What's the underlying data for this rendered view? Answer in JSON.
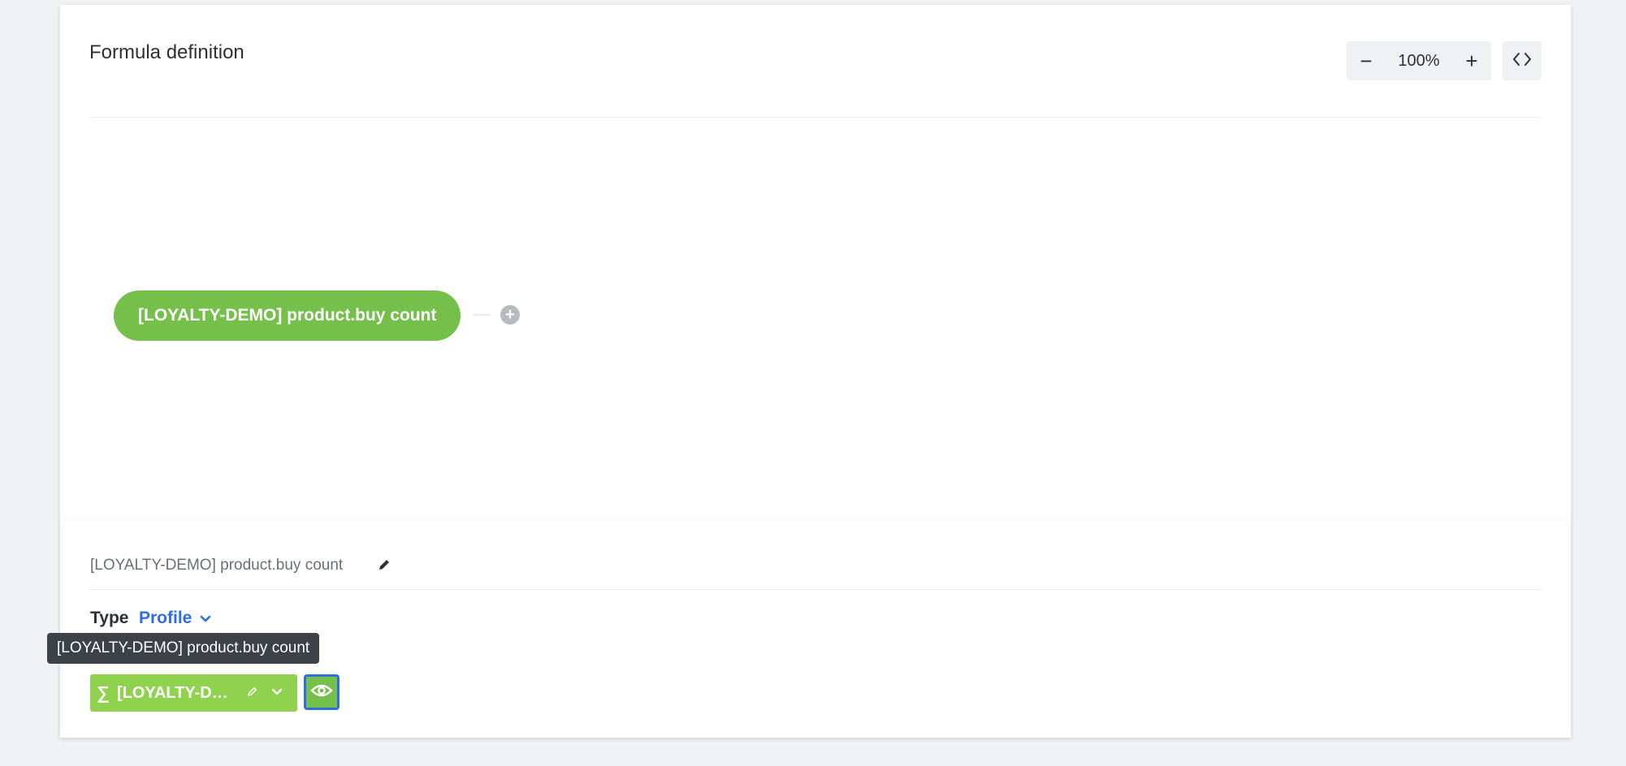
{
  "header": {
    "title": "Formula definition",
    "zoom_out_label": "−",
    "zoom_value": "100%",
    "zoom_in_label": "+"
  },
  "canvas": {
    "node_label": "[LOYALTY-DEMO] product.buy count",
    "add_node_label": "+"
  },
  "details": {
    "formula_name": "[LOYALTY-DEMO] product.buy count",
    "type_label": "Type",
    "type_value": "Profile",
    "tooltip": "[LOYALTY-DEMO] product.buy count",
    "chip_symbol": "∑",
    "chip_label": "[LOYALTY-DEMO] product.buy count"
  },
  "colors": {
    "node_green": "#75c04a",
    "chip_green": "#8ed24d",
    "accent_blue": "#2e6fe0",
    "tooltip_bg": "#3d4148"
  },
  "icons": {
    "code_toggle": "code-brackets-icon",
    "edit": "pencil-icon",
    "dropdown": "chevron-down-icon",
    "preview": "eye-icon"
  }
}
